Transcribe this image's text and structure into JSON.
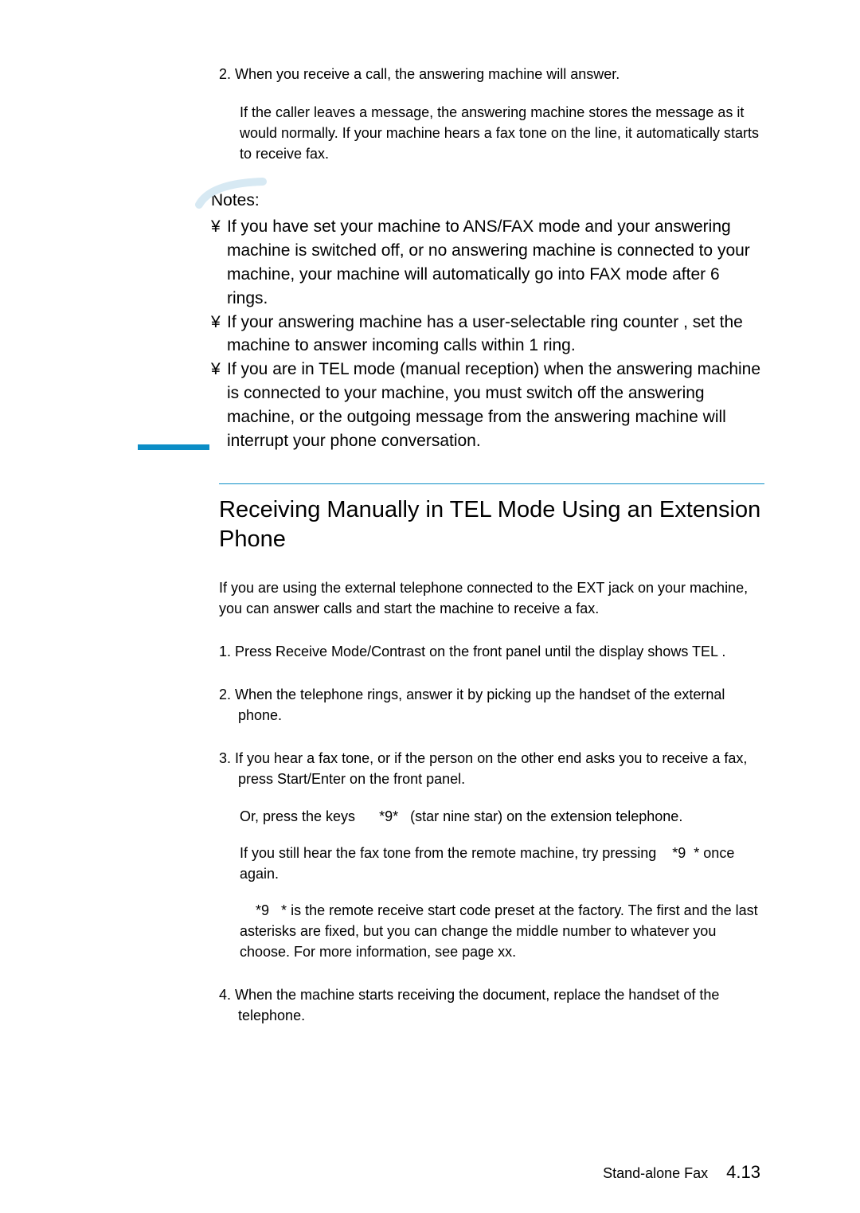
{
  "intro": {
    "step2_line": "2. When you receive a call, the answering machine will answer.",
    "step2_body": "If the caller leaves a message, the answering machine stores the message as it would normally. If your machine hears a fax tone on the line, it automatically starts to receive fax."
  },
  "notes": {
    "heading": "Notes:",
    "bullet_char": "¥",
    "items": [
      "If you have set your machine to ANS/FAX mode and your answering machine is switched off, or no answering machine is connected to your machine, your machine will automatically go into FAX mode after 6 rings.",
      "If your answering machine has a  user-selectable ring counter , set the machine to answer incoming calls within 1 ring.",
      "If you are in TEL mode (manual reception) when the answering machine is connected to your machine, you must switch off the answering machine, or the outgoing message from the answering machine will interrupt your phone conversation."
    ]
  },
  "section": {
    "heading": "Receiving Manually in TEL Mode Using an Extension Phone",
    "intro": "If you are using the external telephone connected to the EXT jack on your machine, you can answer calls and start the machine to receive a fax.",
    "step1": "1. Press   Receive Mode/Contrast         on the front panel until the display shows  TEL .",
    "step2": "2. When the telephone rings, answer it by picking up the handset of the external phone.",
    "step3": "3. If you hear a fax tone, or if the person on the other end asks you to receive a fax, press     Start/Enter       on the front panel.",
    "step3_or": "Or, press the keys        9       (star nine star) on the extension telephone.",
    "step3_if": "If you still hear the fax tone from the remote machine, try pressing       9       once again.",
    "step3_note": "    9       is the remote receive start code preset at the factory. The first and the last asterisks are fixed, but you can change the middle number to whatever you choose. For more information, see page xx.",
    "star": "*",
    "step4": "4. When the machine starts receiving the document, replace the handset of the telephone."
  },
  "footer": {
    "label": "Stand-alone Fax",
    "pageno": "4.13"
  }
}
